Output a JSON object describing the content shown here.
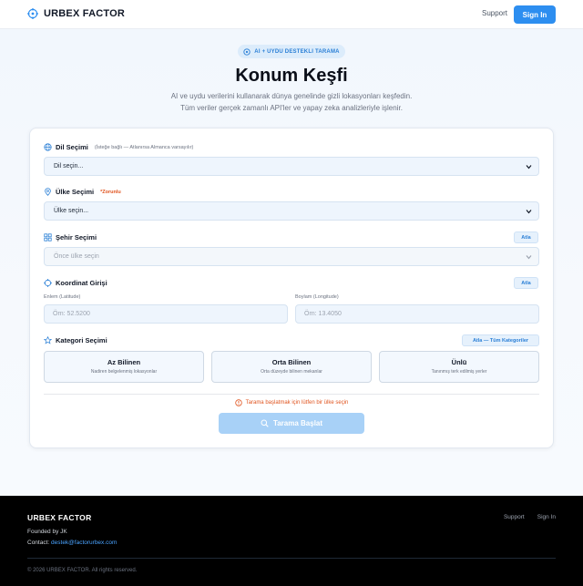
{
  "header": {
    "brand": "URBEX FACTOR",
    "support": "Support",
    "signin": "Sign In"
  },
  "hero": {
    "pill": "AI + UYDU DESTEKLI TARAMA",
    "title": "Konum Keşfi",
    "subtitle_line1": "AI ve uydu verilerini kullanarak dünya genelinde gizli lokasyonları keşfedin.",
    "subtitle_line2": "Tüm veriler gerçek zamanlı API'ler ve yapay zeka analizleriyle işlenir."
  },
  "form": {
    "language": {
      "label": "Dil Seçimi",
      "hint": "(İsteğe bağlı — Atlanırsa Almanca varsayılır)",
      "value": "Dil seçin..."
    },
    "country": {
      "label": "Ülke Seçimi",
      "required": "*Zorunlu",
      "value": "Ülke seçin..."
    },
    "city": {
      "label": "Şehir Seçimi",
      "skip": "Atla",
      "value": "Önce ülke seçin"
    },
    "coords": {
      "label": "Koordinat Girişi",
      "skip": "Atla",
      "lat_label": "Enlem (Latitude)",
      "lat_placeholder": "Örn: 52.5200",
      "lon_label": "Boylam (Longitude)",
      "lon_placeholder": "Örn: 13.4050"
    },
    "category": {
      "label": "Kategori Seçimi",
      "skip": "Atla — Tüm Kategoriler",
      "options": [
        {
          "title": "Az Bilinen",
          "desc": "Nadiren belgelenmiş lokasyonlar"
        },
        {
          "title": "Orta Bilinen",
          "desc": "Orta düzeyde bilinen mekanlar"
        },
        {
          "title": "Ünlü",
          "desc": "Tanınmış terk edilmiş yerler"
        }
      ]
    },
    "warning": "Tarama başlatmak için lütfen bir ülke seçin",
    "submit": "Tarama Başlat"
  },
  "footer": {
    "brand": "URBEX FACTOR",
    "founded": "Founded by JK",
    "contact_label": "Contact:",
    "email": "destek@factorurbex.com",
    "support": "Support",
    "signin": "Sign In",
    "copyright": "© 2026 URBEX FACTOR. All rights reserved."
  },
  "colors": {
    "accent": "#2d8ef0",
    "warning": "#e0541f",
    "footer_bg": "#000000"
  }
}
